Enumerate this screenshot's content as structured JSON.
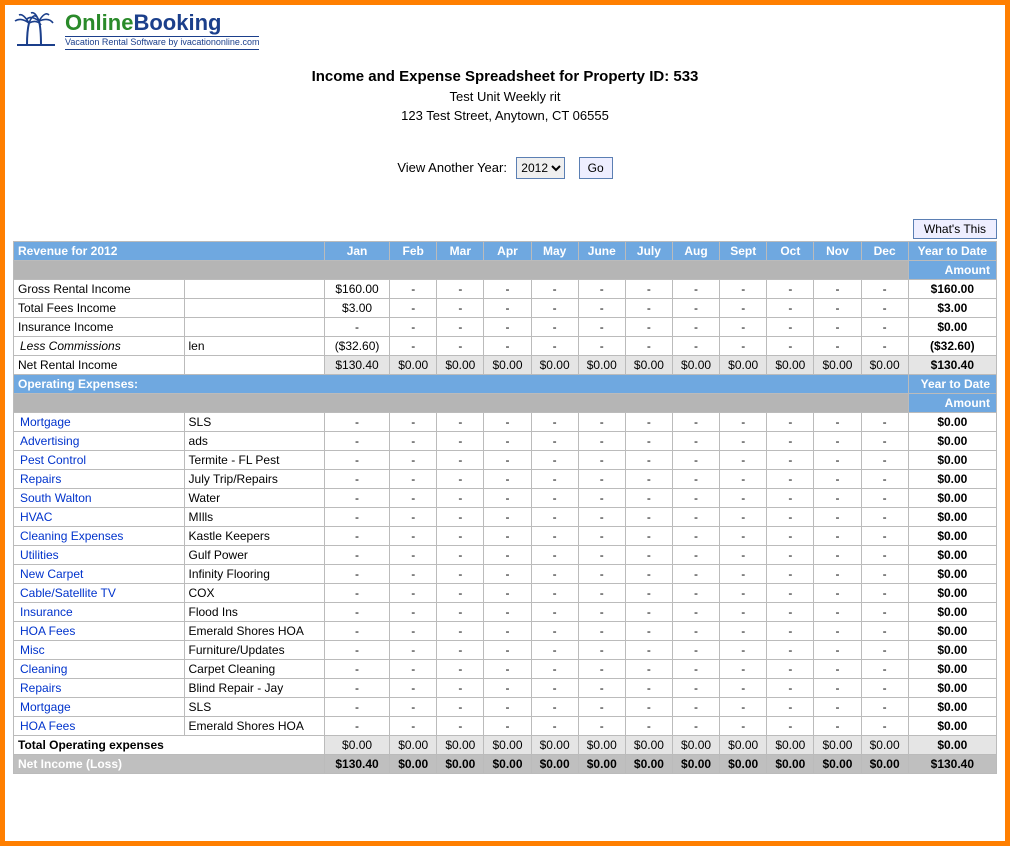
{
  "logo": {
    "word1": "Online",
    "word2": "Booking",
    "tagline": "Vacation Rental Software by ivacationonline.com"
  },
  "header": {
    "title": "Income and Expense Spreadsheet for Property ID: 533",
    "unit": "Test Unit Weekly rit",
    "address": "123 Test Street, Anytown, CT 06555"
  },
  "year_picker": {
    "label": "View Another Year:",
    "selected": "2012",
    "go": "Go"
  },
  "buttons": {
    "whats_this": "What's This"
  },
  "months": [
    "Jan",
    "Feb",
    "Mar",
    "Apr",
    "May",
    "June",
    "July",
    "Aug",
    "Sept",
    "Oct",
    "Nov",
    "Dec"
  ],
  "revenue_header": "Revenue for 2012",
  "ytd_label": "Year to Date",
  "amount_label": "Amount",
  "revenue_rows": [
    {
      "name": "Gross Rental Income",
      "sub": "",
      "vals": [
        "$160.00",
        "-",
        "-",
        "-",
        "-",
        "-",
        "-",
        "-",
        "-",
        "-",
        "-",
        "-"
      ],
      "ytd": "$160.00"
    },
    {
      "name": "Total Fees Income",
      "sub": "",
      "vals": [
        "$3.00",
        "-",
        "-",
        "-",
        "-",
        "-",
        "-",
        "-",
        "-",
        "-",
        "-",
        "-"
      ],
      "ytd": "$3.00"
    },
    {
      "name": "Insurance Income",
      "sub": "",
      "vals": [
        "-",
        "-",
        "-",
        "-",
        "-",
        "-",
        "-",
        "-",
        "-",
        "-",
        "-",
        "-"
      ],
      "ytd": "$0.00"
    },
    {
      "name": "Less Commissions",
      "italic": true,
      "sub": "len",
      "vals": [
        "($32.60)",
        "-",
        "-",
        "-",
        "-",
        "-",
        "-",
        "-",
        "-",
        "-",
        "-",
        "-"
      ],
      "ytd": "($32.60)"
    }
  ],
  "net_rental": {
    "name": "Net Rental Income",
    "vals": [
      "$130.40",
      "$0.00",
      "$0.00",
      "$0.00",
      "$0.00",
      "$0.00",
      "$0.00",
      "$0.00",
      "$0.00",
      "$0.00",
      "$0.00",
      "$0.00"
    ],
    "ytd": "$130.40"
  },
  "opex_header": "Operating Expenses:",
  "opex_rows": [
    {
      "name": "Mortgage",
      "sub": "SLS"
    },
    {
      "name": "Advertising",
      "sub": "ads"
    },
    {
      "name": "Pest Control",
      "sub": "Termite - FL Pest"
    },
    {
      "name": "Repairs",
      "sub": "July Trip/Repairs"
    },
    {
      "name": "South Walton",
      "sub": "Water"
    },
    {
      "name": "HVAC",
      "sub": "MIlls"
    },
    {
      "name": "Cleaning Expenses",
      "sub": "Kastle Keepers"
    },
    {
      "name": "Utilities",
      "sub": "Gulf Power"
    },
    {
      "name": "New Carpet",
      "sub": "Infinity Flooring"
    },
    {
      "name": "Cable/Satellite TV",
      "sub": "COX"
    },
    {
      "name": "Insurance",
      "sub": "Flood Ins"
    },
    {
      "name": "HOA Fees",
      "sub": "Emerald Shores HOA"
    },
    {
      "name": "Misc",
      "sub": "Furniture/Updates"
    },
    {
      "name": "Cleaning",
      "sub": "Carpet Cleaning"
    },
    {
      "name": "Repairs",
      "sub": "Blind Repair - Jay"
    },
    {
      "name": "Mortgage",
      "sub": "SLS"
    },
    {
      "name": "HOA Fees",
      "sub": "Emerald Shores HOA"
    }
  ],
  "opex_dash": "-",
  "opex_ytd": "$0.00",
  "total_opex": {
    "name": "Total Operating expenses",
    "vals": [
      "$0.00",
      "$0.00",
      "$0.00",
      "$0.00",
      "$0.00",
      "$0.00",
      "$0.00",
      "$0.00",
      "$0.00",
      "$0.00",
      "$0.00",
      "$0.00"
    ],
    "ytd": "$0.00"
  },
  "net_income": {
    "name": "Net Income (Loss)",
    "vals": [
      "$130.40",
      "$0.00",
      "$0.00",
      "$0.00",
      "$0.00",
      "$0.00",
      "$0.00",
      "$0.00",
      "$0.00",
      "$0.00",
      "$0.00",
      "$0.00"
    ],
    "ytd": "$130.40"
  }
}
